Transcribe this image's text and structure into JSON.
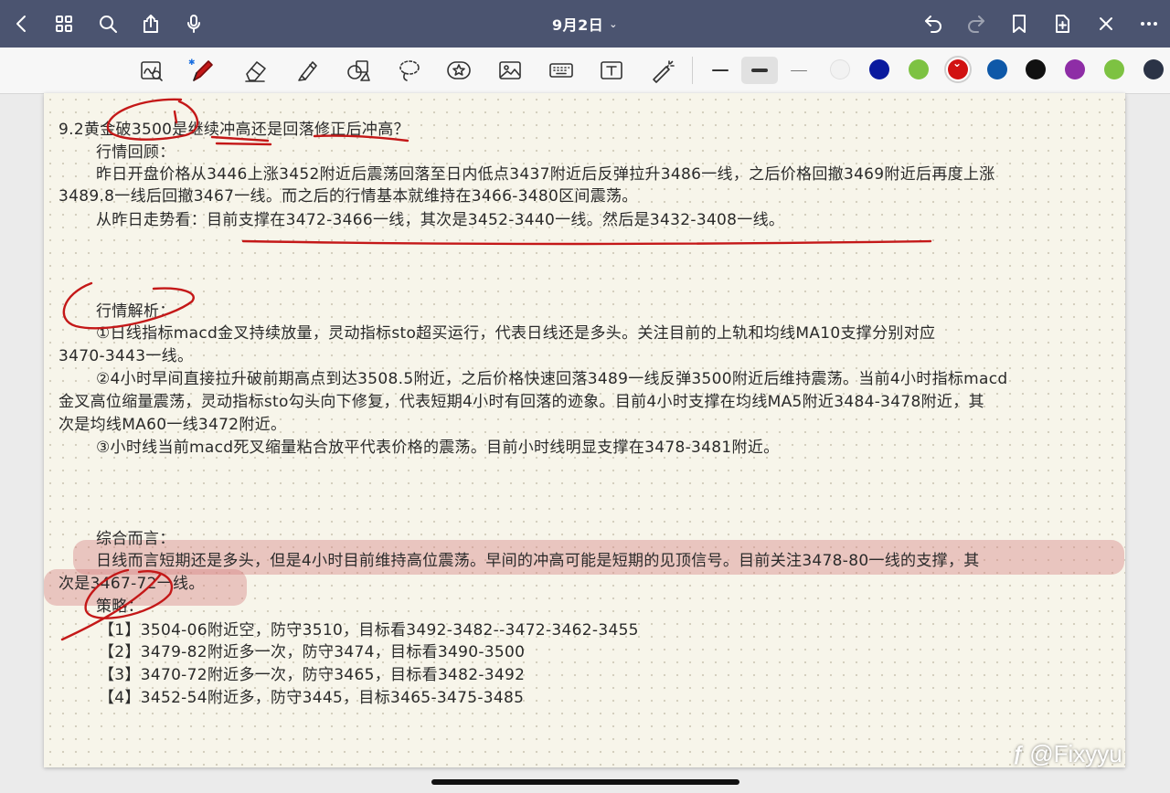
{
  "nav": {
    "title": "9月2日",
    "left_icons": [
      "back-icon",
      "grid-icon",
      "search-icon",
      "share-icon",
      "microphone-icon"
    ],
    "right_icons": [
      "undo-icon",
      "redo-icon",
      "bookmark-icon",
      "add-page-icon",
      "close-icon",
      "more-icon"
    ]
  },
  "toolbar": {
    "tools": [
      "zoom-window-icon",
      "pen-icon",
      "eraser-icon",
      "highlighter-icon",
      "shapes-icon",
      "lasso-icon",
      "sticker-icon",
      "image-icon",
      "keyboard-icon",
      "text-box-icon",
      "laser-pointer-icon"
    ],
    "stroke_widths": [
      "thin",
      "medium",
      "thinnest"
    ],
    "selected_stroke": "medium",
    "colors": [
      "#f2f2f2",
      "#0a1a9e",
      "#7dc242",
      "#d11212",
      "#0e58a8",
      "#111111",
      "#8e2da6",
      "#7dc242",
      "#2b3346"
    ],
    "selected_color": "#d11212"
  },
  "note": {
    "title": "9.2黄金破3500是继续冲高还是回落修正后冲高？",
    "review_heading": "行情回顾：",
    "review_p1_l1": "昨日开盘价格从3446上涨3452附近后震荡回落至日内低点3437附近后反弹拉升3486一线，之后价格回撤3469附近后再度上涨",
    "review_p1_l2": "3489.8一线后回撤3467一线。而之后的行情基本就维持在3466-3480区间震荡。",
    "review_p2": "从昨日走势看：目前支撑在3472-3466一线，其次是3452-3440一线。然后是3432-3408一线。",
    "analysis_heading": "行情解析：",
    "a1_l1": "①日线指标macd金叉持续放量，灵动指标sto超买运行，代表日线还是多头。关注目前的上轨和均线MA10支撑分别对应",
    "a1_l2": "3470-3443一线。",
    "a2_l1": "②4小时早间直接拉升破前期高点到达3508.5附近，之后价格快速回落3489一线反弹3500附近后维持震荡。当前4小时指标macd",
    "a2_l2": "金叉高位缩量震荡，灵动指标sto勾头向下修复，代表短期4小时有回落的迹象。目前4小时支撑在均线MA5附近3484-3478附近，其",
    "a2_l3": "次是均线MA60一线3472附近。",
    "a3": "③小时线当前macd死叉缩量粘合放平代表价格的震荡。目前小时线明显支撑在3478-3481附近。",
    "summary_heading": "综合而言：",
    "summary_l1": "日线而言短期还是多头，但是4小时目前维持高位震荡。早间的冲高可能是短期的见顶信号。目前关注3478-80一线的支撑，其",
    "summary_l2": "次是3467-72一线。",
    "strategy_heading": "策略：",
    "s1": "【1】3504-06附近空，防守3510，目标看3492-3482--3472-3462-3455",
    "s2": "【2】3479-82附近多一次，防守3474，目标看3490-3500",
    "s3": "【3】3470-72附近多一次，防守3465，目标看3482-3492",
    "s4": "【4】3452-54附近多，防守3445，目标3465-3475-3485"
  },
  "watermark": {
    "logo": "ƒ",
    "text": "@Fixyyu"
  }
}
